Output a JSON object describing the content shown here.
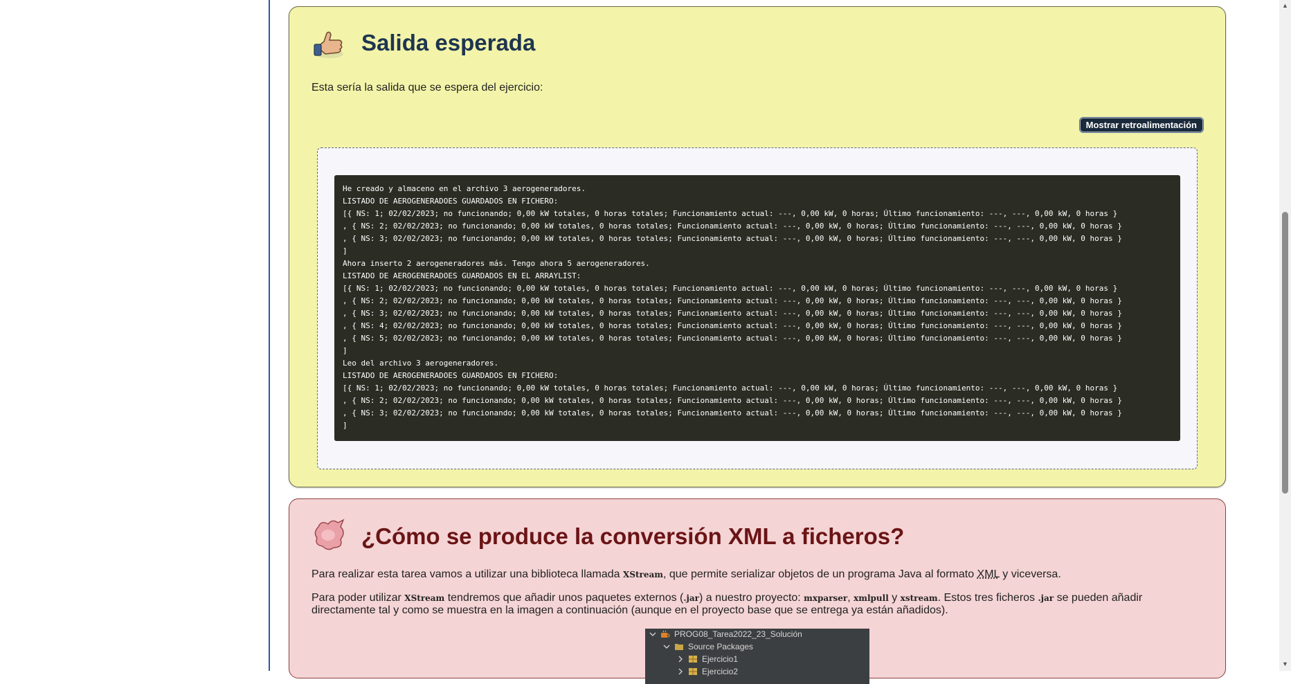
{
  "expected_output": {
    "title": "Salida esperada",
    "intro": "Esta sería la salida que se espera del ejercicio:",
    "feedback_button": "Mostrar retroalimentación",
    "console_lines": [
      "He creado y almaceno en el archivo 3 aerogeneradores.",
      "LISTADO DE AEROGENERADOES GUARDADOS EN FICHERO:",
      "[{ NS: 1; 02/02/2023; no funcionando; 0,00 kW totales, 0 horas totales; Funcionamiento actual: ---, 0,00 kW, 0 horas; Último funcionamiento: ---, ---, 0,00 kW, 0 horas }",
      ", { NS: 2; 02/02/2023; no funcionando; 0,00 kW totales, 0 horas totales; Funcionamiento actual: ---, 0,00 kW, 0 horas; Último funcionamiento: ---, ---, 0,00 kW, 0 horas }",
      ", { NS: 3; 02/02/2023; no funcionando; 0,00 kW totales, 0 horas totales; Funcionamiento actual: ---, 0,00 kW, 0 horas; Último funcionamiento: ---, ---, 0,00 kW, 0 horas }",
      "]",
      "Ahora inserto 2 aerogeneradores más. Tengo ahora 5 aerogeneradores.",
      "LISTADO DE AEROGENERADOES GUARDADOS EN EL ARRAYLIST:",
      "[{ NS: 1; 02/02/2023; no funcionando; 0,00 kW totales, 0 horas totales; Funcionamiento actual: ---, 0,00 kW, 0 horas; Último funcionamiento: ---, ---, 0,00 kW, 0 horas }",
      ", { NS: 2; 02/02/2023; no funcionando; 0,00 kW totales, 0 horas totales; Funcionamiento actual: ---, 0,00 kW, 0 horas; Último funcionamiento: ---, ---, 0,00 kW, 0 horas }",
      ", { NS: 3; 02/02/2023; no funcionando; 0,00 kW totales, 0 horas totales; Funcionamiento actual: ---, 0,00 kW, 0 horas; Último funcionamiento: ---, ---, 0,00 kW, 0 horas }",
      ", { NS: 4; 02/02/2023; no funcionando; 0,00 kW totales, 0 horas totales; Funcionamiento actual: ---, 0,00 kW, 0 horas; Último funcionamiento: ---, ---, 0,00 kW, 0 horas }",
      ", { NS: 5; 02/02/2023; no funcionando; 0,00 kW totales, 0 horas totales; Funcionamiento actual: ---, 0,00 kW, 0 horas; Último funcionamiento: ---, ---, 0,00 kW, 0 horas }",
      "]",
      "Leo del archivo 3 aerogeneradores.",
      "LISTADO DE AEROGENERADOES GUARDADOS EN FICHERO:",
      "[{ NS: 1; 02/02/2023; no funcionando; 0,00 kW totales, 0 horas totales; Funcionamiento actual: ---, 0,00 kW, 0 horas; Último funcionamiento: ---, ---, 0,00 kW, 0 horas }",
      ", { NS: 2; 02/02/2023; no funcionando; 0,00 kW totales, 0 horas totales; Funcionamiento actual: ---, 0,00 kW, 0 horas; Último funcionamiento: ---, ---, 0,00 kW, 0 horas }",
      ", { NS: 3; 02/02/2023; no funcionando; 0,00 kW totales, 0 horas totales; Funcionamiento actual: ---, 0,00 kW, 0 horas; Último funcionamiento: ---, ---, 0,00 kW, 0 horas }",
      "]"
    ]
  },
  "conversion": {
    "title": "¿Cómo se produce la conversión XML a ficheros?",
    "p1_a": "Para realizar esta tarea vamos a utilizar una biblioteca llamada ",
    "p1_lib": "XStream",
    "p1_b": ", que permite serializar objetos de un programa Java al formato ",
    "p1_xml": "XML",
    "p1_c": " y viceversa.",
    "p2_a": "Para poder utilizar ",
    "p2_lib": "XStream",
    "p2_b": " tendremos que añadir unos paquetes externos (",
    "p2_jar": ".jar",
    "p2_c": ") a nuestro proyecto: ",
    "p2_pkg1": "mxparser",
    "p2_sep1": ", ",
    "p2_pkg2": "xmlpull",
    "p2_sep2": " y ",
    "p2_pkg3": "xstream",
    "p2_d": ". Estos tres ficheros ",
    "p2_jar2": ".jar",
    "p2_e": " se pueden añadir directamente tal y como se muestra en la imagen a continuación (aunque en el proyecto base que se entrega ya están añadidos)."
  },
  "ide_tree": {
    "project": "PROG08_Tarea2022_23_Solución",
    "source_packages": "Source Packages",
    "pkg1": "Ejercicio1",
    "pkg2": "Ejercicio2"
  },
  "colors": {
    "yellow_box": "#f3f4a9",
    "red_box": "#f5d4d5",
    "terminal_bg": "#2b2c24",
    "title_blue": "#1e3550",
    "title_red": "#6a1416"
  }
}
